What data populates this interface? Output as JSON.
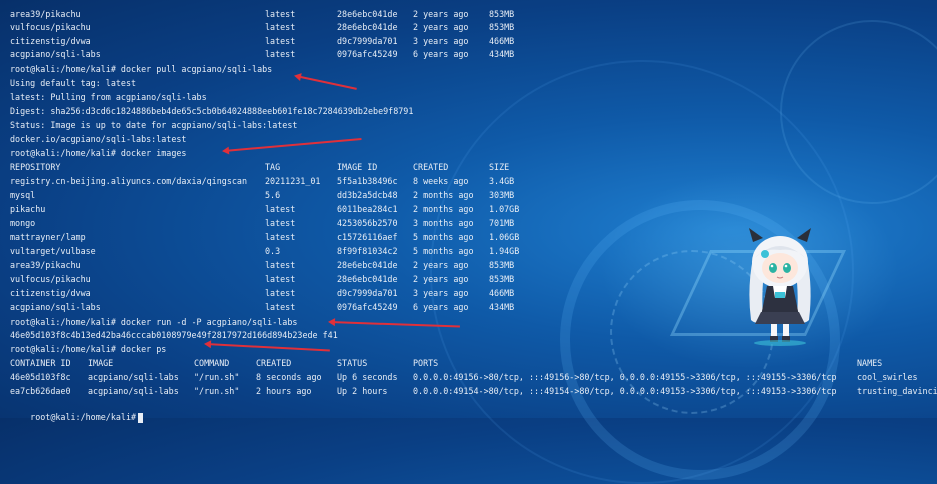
{
  "top_images": [
    {
      "repository": "area39/pikachu",
      "tag": "latest",
      "image_id": "28e6ebc041de",
      "created": "2 years ago",
      "size": "853MB"
    },
    {
      "repository": "vulfocus/pikachu",
      "tag": "latest",
      "image_id": "28e6ebc041de",
      "created": "2 years ago",
      "size": "853MB"
    },
    {
      "repository": "citizenstig/dvwa",
      "tag": "latest",
      "image_id": "d9c7999da701",
      "created": "3 years ago",
      "size": "466MB"
    },
    {
      "repository": "acgpiano/sqli-labs",
      "tag": "latest",
      "image_id": "0976afc45249",
      "created": "6 years ago",
      "size": "434MB"
    }
  ],
  "pull": {
    "prompt": "root@kali:/home/kali# docker pull acgpiano/sqli-labs",
    "output": [
      "Using default tag: latest",
      "latest: Pulling from acgpiano/sqli-labs",
      "Digest: sha256:d3cd6c1824886beb4de65c5cb0b64024888eeb601fe18c7284639db2ebe9f8791",
      "Status: Image is up to date for acgpiano/sqli-labs:latest",
      "docker.io/acgpiano/sqli-labs:latest"
    ]
  },
  "images_cmd": "root@kali:/home/kali# docker images",
  "images_header": {
    "repository": "REPOSITORY",
    "tag": "TAG",
    "image_id": "IMAGE ID",
    "created": "CREATED",
    "size": "SIZE"
  },
  "images": [
    {
      "repository": "registry.cn-beijing.aliyuncs.com/daxia/qingscan",
      "tag": "20211231_01",
      "image_id": "5f5a1b38496c",
      "created": "8 weeks ago",
      "size": "3.4GB"
    },
    {
      "repository": "mysql",
      "tag": "5.6",
      "image_id": "dd3b2a5dcb48",
      "created": "2 months ago",
      "size": "303MB"
    },
    {
      "repository": "pikachu",
      "tag": "latest",
      "image_id": "6011bea284c1",
      "created": "2 months ago",
      "size": "1.07GB"
    },
    {
      "repository": "mongo",
      "tag": "latest",
      "image_id": "4253056b2570",
      "created": "3 months ago",
      "size": "701MB"
    },
    {
      "repository": "mattrayner/lamp",
      "tag": "latest",
      "image_id": "c15726116aef",
      "created": "5 months ago",
      "size": "1.06GB"
    },
    {
      "repository": "vultarget/vulbase",
      "tag": "0.3",
      "image_id": "8f99f81034c2",
      "created": "5 months ago",
      "size": "1.94GB"
    },
    {
      "repository": "area39/pikachu",
      "tag": "latest",
      "image_id": "28e6ebc041de",
      "created": "2 years ago",
      "size": "853MB"
    },
    {
      "repository": "vulfocus/pikachu",
      "tag": "latest",
      "image_id": "28e6ebc041de",
      "created": "2 years ago",
      "size": "853MB"
    },
    {
      "repository": "citizenstig/dvwa",
      "tag": "latest",
      "image_id": "d9c7999da701",
      "created": "3 years ago",
      "size": "466MB"
    },
    {
      "repository": "acgpiano/sqli-labs",
      "tag": "latest",
      "image_id": "0976afc45249",
      "created": "6 years ago",
      "size": "434MB"
    }
  ],
  "run": {
    "prompt": "root@kali:/home/kali# docker run -d -P acgpiano/sqli-labs",
    "output": "46e05d103f8c4b13ed42ba46cccab0108979e49f2817972d166d894b23ede f41"
  },
  "ps_cmd": "root@kali:/home/kali# docker ps",
  "ps_header": {
    "id": "CONTAINER ID",
    "image": "IMAGE",
    "command": "COMMAND",
    "created": "CREATED",
    "status": "STATUS",
    "ports": "PORTS",
    "names": "NAMES"
  },
  "containers": [
    {
      "id": "46e05d103f8c",
      "image": "acgpiano/sqli-labs",
      "command": "\"/run.sh\"",
      "created": "8 seconds ago",
      "status": "Up 6 seconds",
      "ports": "0.0.0.0:49156->80/tcp, :::49156->80/tcp, 0.0.0.0:49155->3306/tcp, :::49155->3306/tcp",
      "names": "cool_swirles"
    },
    {
      "id": "ea7cb626dae0",
      "image": "acgpiano/sqli-labs",
      "command": "\"/run.sh\"",
      "created": "2 hours ago",
      "status": "Up 2 hours",
      "ports": "0.0.0.0:49154->80/tcp, :::49154->80/tcp, 0.0.0.0:49153->3306/tcp, :::49153->3306/tcp",
      "names": "trusting_davinci"
    }
  ],
  "final_prompt": "root@kali:/home/kali#",
  "colors": {
    "annotation_arrow": "#e0303a",
    "terminal_text": "#e8eef6",
    "background": "#0f5aa8"
  }
}
